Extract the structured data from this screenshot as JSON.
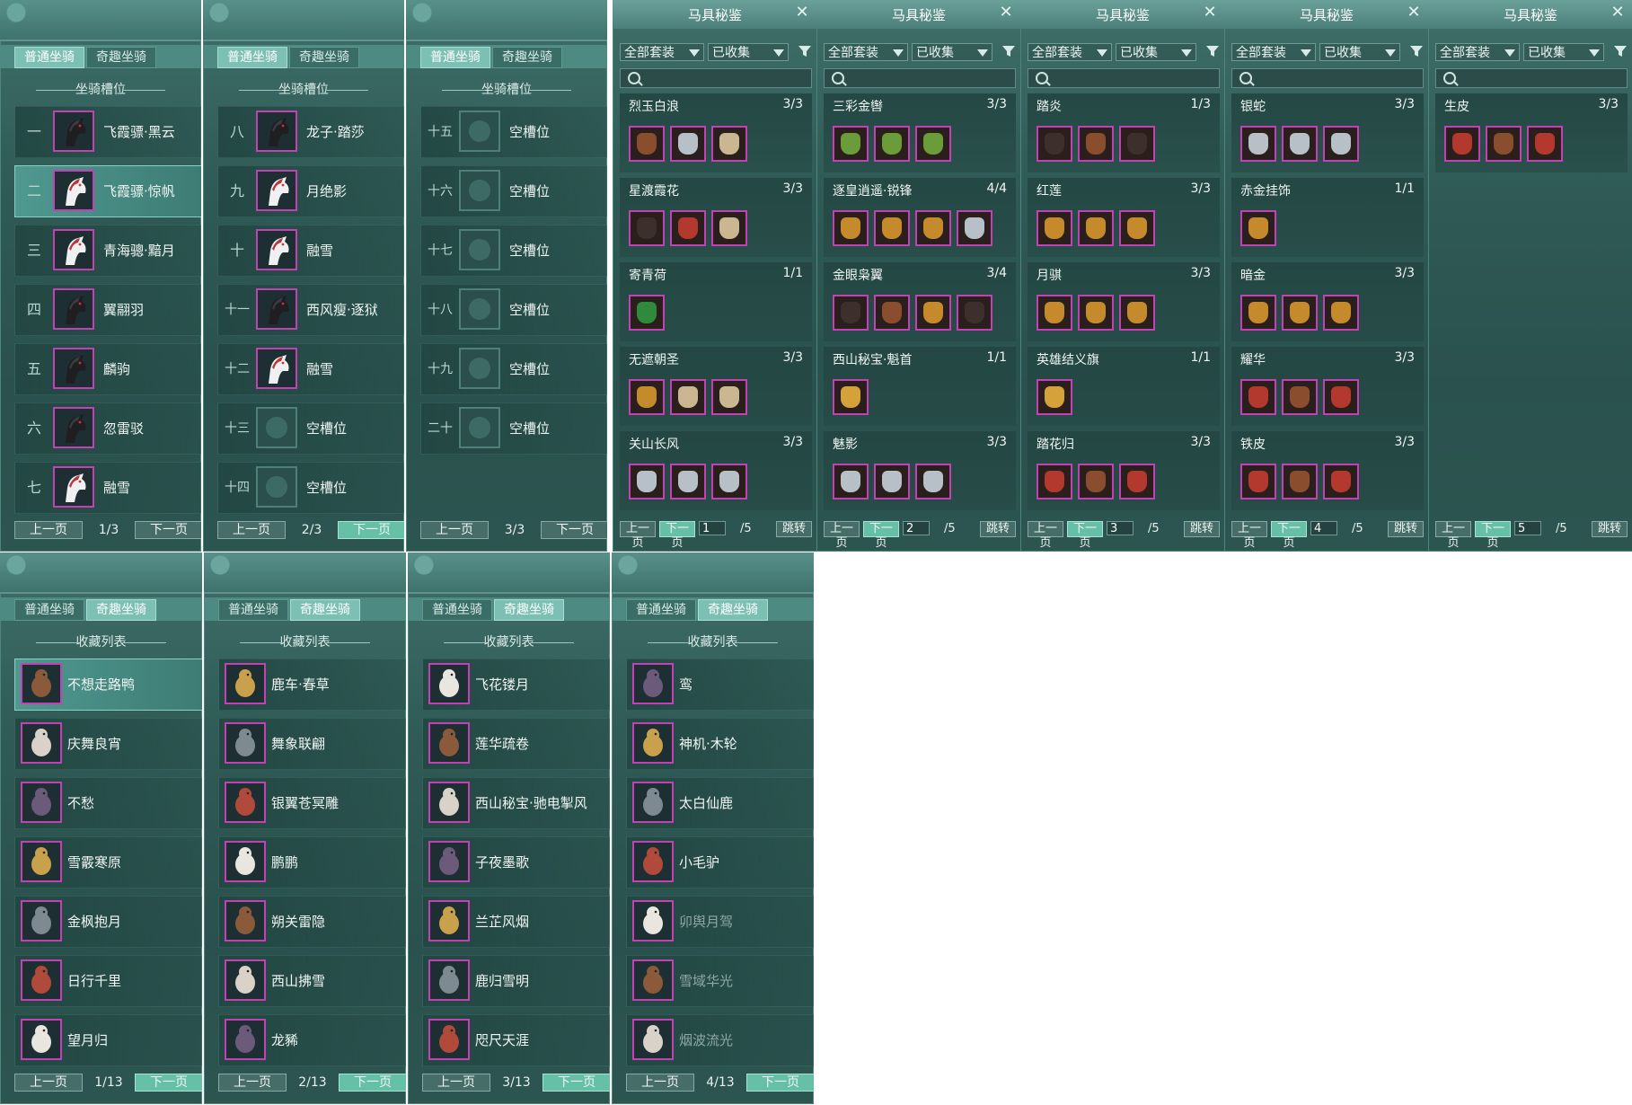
{
  "mount_tabs": [
    "普通坐骑",
    "奇趣坐骑"
  ],
  "slots_panels": [
    {
      "section_title": "坐骑槽位",
      "rows": [
        {
          "num": "一",
          "name": "飞霞骠·黑云",
          "horse": "black"
        },
        {
          "num": "二",
          "name": "飞霞骠·惊帆",
          "horse": "white",
          "selected": true
        },
        {
          "num": "三",
          "name": "青海骢·黯月",
          "horse": "white"
        },
        {
          "num": "四",
          "name": "翼翮羽",
          "horse": "black"
        },
        {
          "num": "五",
          "name": "麟驹",
          "horse": "black"
        },
        {
          "num": "六",
          "name": "忽雷驳",
          "horse": "black"
        },
        {
          "num": "七",
          "name": "融雪",
          "horse": "white"
        }
      ],
      "pager": {
        "prev": "上一页",
        "page": "1/3",
        "next": "下一页"
      }
    },
    {
      "section_title": "坐骑槽位",
      "rows": [
        {
          "num": "八",
          "name": "龙子·踏莎",
          "horse": "black"
        },
        {
          "num": "九",
          "name": "月绝影",
          "horse": "white"
        },
        {
          "num": "十",
          "name": "融雪",
          "horse": "white"
        },
        {
          "num": "十一",
          "name": "西风瘦·逐狱",
          "horse": "black"
        },
        {
          "num": "十二",
          "name": "融雪",
          "horse": "white"
        },
        {
          "num": "十三",
          "name": "空槽位",
          "horse": "empty"
        },
        {
          "num": "十四",
          "name": "空槽位",
          "horse": "empty"
        }
      ],
      "pager": {
        "prev": "上一页",
        "page": "2/3",
        "next": "下一页"
      }
    },
    {
      "section_title": "坐骑槽位",
      "rows": [
        {
          "num": "十五",
          "name": "空槽位",
          "horse": "empty"
        },
        {
          "num": "十六",
          "name": "空槽位",
          "horse": "empty"
        },
        {
          "num": "十七",
          "name": "空槽位",
          "horse": "empty"
        },
        {
          "num": "十八",
          "name": "空槽位",
          "horse": "empty"
        },
        {
          "num": "十九",
          "name": "空槽位",
          "horse": "empty"
        },
        {
          "num": "二十",
          "name": "空槽位",
          "horse": "empty"
        }
      ],
      "pager": {
        "prev": "上一页",
        "page": "3/3",
        "next": "下一页"
      }
    }
  ],
  "equip_panels": [
    {
      "title": "马具秘鉴",
      "filter_all": "全部套装",
      "filter_collected": "已收集",
      "sets": [
        {
          "name": "烈玉白浪",
          "count": "3/3",
          "items": [
            "bronze",
            "silver",
            "tan"
          ]
        },
        {
          "name": "星渡霞花",
          "count": "3/3",
          "items": [
            "dark",
            "red",
            "tan"
          ]
        },
        {
          "name": "寄青荷",
          "count": "1/1",
          "items": [
            "leaf"
          ]
        },
        {
          "name": "无遮朝圣",
          "count": "3/3",
          "items": [
            "gold",
            "tan",
            "tan"
          ]
        },
        {
          "name": "关山长风",
          "count": "3/3",
          "items": [
            "silver",
            "silver",
            "silver"
          ]
        }
      ],
      "pager": {
        "prev": "上一页",
        "next": "下一页",
        "page": "1",
        "total": "/5",
        "jump": "跳转"
      }
    },
    {
      "title": "马具秘鉴",
      "filter_all": "全部套装",
      "filter_collected": "已收集",
      "sets": [
        {
          "name": "三彩金辔",
          "count": "3/3",
          "items": [
            "green",
            "green",
            "green"
          ]
        },
        {
          "name": "逐皇逍遥·锐锋",
          "count": "4/4",
          "items": [
            "gold",
            "gold",
            "gold",
            "silver"
          ]
        },
        {
          "name": "金眼枭翼",
          "count": "3/4",
          "items": [
            "dark",
            "bronze",
            "gold",
            "dark"
          ]
        },
        {
          "name": "西山秘宝·魁首",
          "count": "1/1",
          "items": [
            "scroll"
          ]
        },
        {
          "name": "魅影",
          "count": "3/3",
          "items": [
            "silver",
            "silver",
            "silver"
          ]
        }
      ],
      "pager": {
        "prev": "上一页",
        "next": "下一页",
        "page": "2",
        "total": "/5",
        "jump": "跳转"
      }
    },
    {
      "title": "马具秘鉴",
      "filter_all": "全部套装",
      "filter_collected": "已收集",
      "sets": [
        {
          "name": "踏炎",
          "count": "1/3",
          "items": [
            "dark",
            "bronze",
            "dark"
          ]
        },
        {
          "name": "红莲",
          "count": "3/3",
          "items": [
            "gold",
            "gold",
            "gold"
          ]
        },
        {
          "name": "月骐",
          "count": "3/3",
          "items": [
            "gold",
            "gold",
            "gold"
          ]
        },
        {
          "name": "英雄结义旗",
          "count": "1/1",
          "items": [
            "scroll"
          ]
        },
        {
          "name": "踏花归",
          "count": "3/3",
          "items": [
            "red",
            "bronze",
            "red"
          ]
        }
      ],
      "pager": {
        "prev": "上一页",
        "next": "下一页",
        "page": "3",
        "total": "/5",
        "jump": "跳转"
      }
    },
    {
      "title": "马具秘鉴",
      "filter_all": "全部套装",
      "filter_collected": "已收集",
      "sets": [
        {
          "name": "银蛇",
          "count": "3/3",
          "items": [
            "silver",
            "silver",
            "silver"
          ]
        },
        {
          "name": "赤金挂饰",
          "count": "1/1",
          "items": [
            "gold"
          ]
        },
        {
          "name": "暗金",
          "count": "3/3",
          "items": [
            "gold",
            "gold",
            "gold"
          ]
        },
        {
          "name": "耀华",
          "count": "3/3",
          "items": [
            "red",
            "bronze",
            "red"
          ]
        },
        {
          "name": "铁皮",
          "count": "3/3",
          "items": [
            "red",
            "bronze",
            "red"
          ]
        }
      ],
      "pager": {
        "prev": "上一页",
        "next": "下一页",
        "page": "4",
        "total": "/5",
        "jump": "跳转"
      }
    },
    {
      "title": "马具秘鉴",
      "filter_all": "全部套装",
      "filter_collected": "已收集",
      "sets": [
        {
          "name": "生皮",
          "count": "3/3",
          "items": [
            "red",
            "bronze",
            "red"
          ]
        }
      ],
      "pager": {
        "prev": "上一页",
        "next": "下一页",
        "page": "5",
        "total": "/5",
        "jump": "跳转"
      }
    }
  ],
  "collection_panels": [
    {
      "section_title": "收藏列表",
      "rows": [
        {
          "name": "不想走路鸭",
          "selected": true
        },
        {
          "name": "庆舞良宵"
        },
        {
          "name": "不愁"
        },
        {
          "name": "雪霰寒原"
        },
        {
          "name": "金枫抱月"
        },
        {
          "name": "日行千里"
        },
        {
          "name": "望月归"
        }
      ],
      "pager": {
        "prev": "上一页",
        "page": "1/13",
        "next": "下一页"
      }
    },
    {
      "section_title": "收藏列表",
      "rows": [
        {
          "name": "鹿车·春草"
        },
        {
          "name": "舞象联翩"
        },
        {
          "name": "银翼苍冥雕"
        },
        {
          "name": "鹏鹏"
        },
        {
          "name": "朔关雷隐"
        },
        {
          "name": "西山拂雪"
        },
        {
          "name": "龙豨"
        }
      ],
      "pager": {
        "prev": "上一页",
        "page": "2/13",
        "next": "下一页"
      }
    },
    {
      "section_title": "收藏列表",
      "rows": [
        {
          "name": "飞花镂月"
        },
        {
          "name": "莲华疏卷"
        },
        {
          "name": "西山秘宝·驰电掣风"
        },
        {
          "name": "子夜墨歌"
        },
        {
          "name": "兰芷风烟"
        },
        {
          "name": "鹿归雪明"
        },
        {
          "name": "咫尺天涯"
        }
      ],
      "pager": {
        "prev": "上一页",
        "page": "3/13",
        "next": "下一页"
      }
    },
    {
      "section_title": "收藏列表",
      "rows": [
        {
          "name": "鸾"
        },
        {
          "name": "神机·木轮"
        },
        {
          "name": "太白仙鹿"
        },
        {
          "name": "小毛驴"
        },
        {
          "name": "卯舆月驾",
          "dim": true
        },
        {
          "name": "雪域华光",
          "dim": true
        },
        {
          "name": "烟波流光",
          "dim": true
        }
      ],
      "pager": {
        "prev": "上一页",
        "page": "4/13",
        "next": "下一页"
      }
    }
  ]
}
